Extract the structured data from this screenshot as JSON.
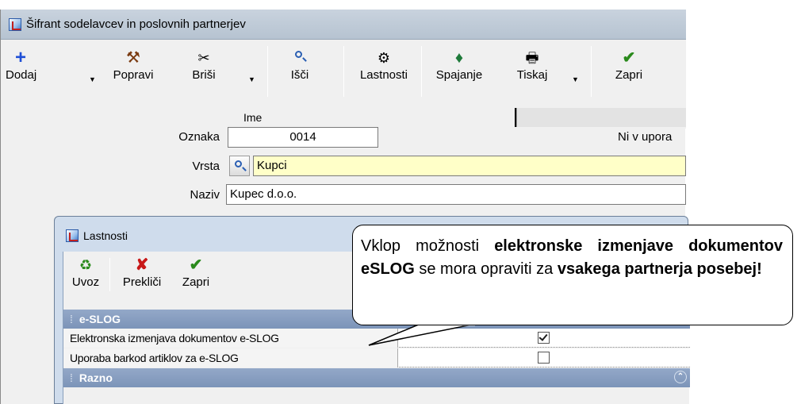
{
  "main_window": {
    "title": "Šifrant sodelavcev in poslovnih partnerjev",
    "toolbar": {
      "dodaj": "Dodaj",
      "popravi": "Popravi",
      "brisi": "Briši",
      "isci": "Išči",
      "lastnosti": "Lastnosti",
      "spajanje": "Spajanje",
      "tiskaj": "Tiskaj",
      "zapri": "Zapri"
    },
    "column_header": "Ime",
    "form": {
      "oznaka_label": "Oznaka",
      "oznaka_value": "0014",
      "vrsta_label": "Vrsta",
      "vrsta_value": "Kupci",
      "naziv_label": "Naziv",
      "naziv_value": "Kupec d.o.o."
    },
    "status_text": "Ni v upora"
  },
  "dialog": {
    "title": "Lastnosti",
    "toolbar": {
      "uvoz": "Uvoz",
      "preklici": "Prekliči",
      "zapri": "Zapri"
    },
    "sections": {
      "eslog": "e-SLOG",
      "razno": "Razno"
    },
    "properties": [
      {
        "name": "Elektronska izmenjava dokumentov e-SLOG",
        "checked": true
      },
      {
        "name": "Uporaba barkod artiklov za e-SLOG",
        "checked": false
      }
    ]
  },
  "callout": {
    "part1": "Vklop možnosti ",
    "bold1": "elektronske izmenjave dokumentov eSLOG",
    "part2": " se mora opraviti za ",
    "bold2": "vsakega partnerja posebej!"
  },
  "colors": {
    "title_bar": "#bcc8d6",
    "section_header": "#8aa0c2",
    "highlight_field": "#ffffc8",
    "add_icon": "#1f4fd6",
    "delete_icon": "#c81818",
    "ok_icon": "#2a8a1c"
  },
  "icons": {
    "dodaj": "plus-icon",
    "popravi": "hammer-icon",
    "brisi": "scissors-icon",
    "isci": "search-icon",
    "lastnosti": "gears-icon",
    "spajanje": "merge-icon",
    "tiskaj": "printer-icon",
    "zapri": "checkmark-icon",
    "uvoz": "import-icon",
    "preklici": "cancel-icon"
  }
}
